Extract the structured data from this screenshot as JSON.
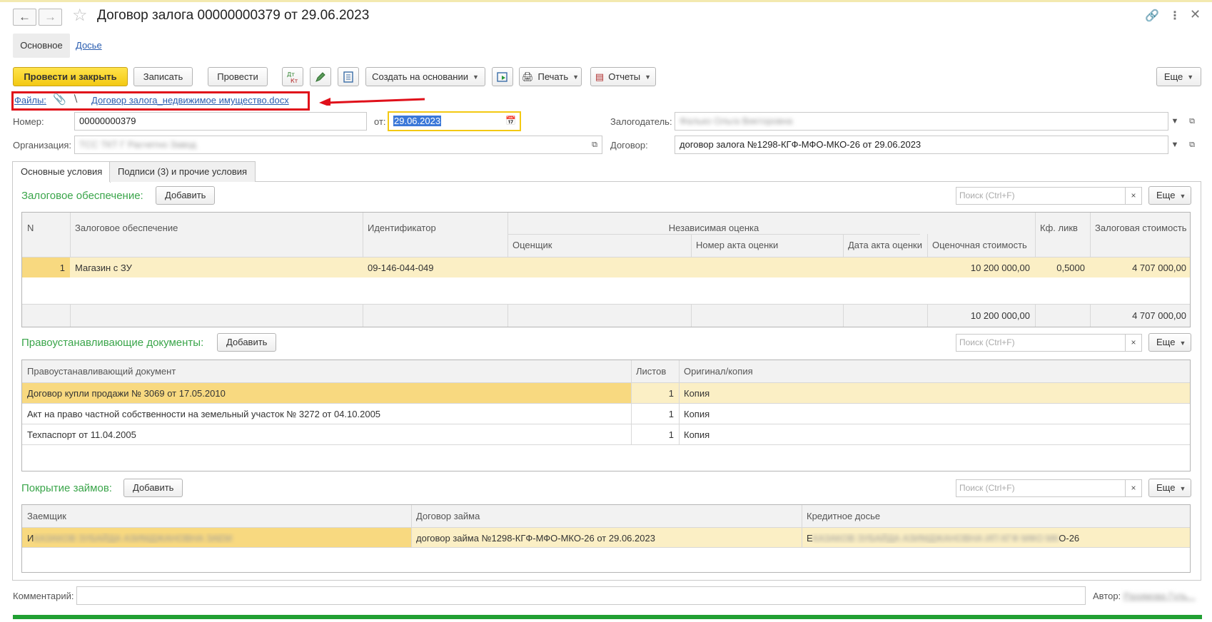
{
  "window": {
    "title": "Договор залога 00000000379 от 29.06.2023"
  },
  "section_tabs": [
    {
      "label": "Основное"
    },
    {
      "label": "Досье"
    }
  ],
  "toolbar": {
    "post_close": "Провести и закрыть",
    "save": "Записать",
    "post": "Провести",
    "create_based": "Создать на основании",
    "print": "Печать",
    "reports": "Отчеты",
    "more": "Еще"
  },
  "files": {
    "label": "Файлы:",
    "file_name": "Договор залога_недвижимое имущество.docx"
  },
  "fields": {
    "number_label": "Номер:",
    "number_value": "00000000379",
    "date_label": "от:",
    "date_value": "29.06.2023",
    "pledger_label": "Залогодатель:",
    "pledger_value": "Фалько Ольга Викторовна",
    "org_label": "Организация:",
    "org_value": "ТСС ТКТ Г Расчетно Завод",
    "contract_label": "Договор:",
    "contract_value": "договор залога №1298-КГФ-МФО-МКО-26 от 29.06.2023"
  },
  "tabs": [
    {
      "label": "Основные условия"
    },
    {
      "label": "Подписи (3) и прочие условия"
    }
  ],
  "collateral": {
    "title": "Залоговое обеспечение:",
    "add": "Добавить",
    "search_placeholder": "Поиск (Ctrl+F)",
    "more": "Еще",
    "headers": {
      "n": "N",
      "collateral": "Залоговое обеспечение",
      "identifier": "Идентификатор",
      "independent": "Независимая оценка",
      "appraiser": "Оценщик",
      "act_number": "Номер акта оценки",
      "act_date": "Дата акта оценки",
      "appraised_value": "Оценочная стоимость",
      "liq_coef": "Кф. ликв",
      "pledge_value": "Залоговая стоимость"
    },
    "rows": [
      {
        "n": "1",
        "collateral": "Магазин с ЗУ",
        "identifier": "09-146-044-049",
        "appraiser": "",
        "act_number": "",
        "act_date": "",
        "appraised_value": "10 200 000,00",
        "liq_coef": "0,5000",
        "pledge_value": "4 707 000,00"
      }
    ],
    "totals": {
      "appraised_value": "10 200 000,00",
      "pledge_value": "4 707 000,00"
    }
  },
  "title_docs": {
    "title": "Правоустанавливающие документы:",
    "add": "Добавить",
    "search_placeholder": "Поиск (Ctrl+F)",
    "more": "Еще",
    "headers": {
      "doc": "Правоустанавливающий документ",
      "sheets": "Листов",
      "original": "Оригинал/копия"
    },
    "rows": [
      {
        "doc": "Договор купли продажи № 3069 от 17.05.2010",
        "sheets": "1",
        "original": "Копия"
      },
      {
        "doc": "Акт на право частной собственности на земельный участок № 3272 от 04.10.2005",
        "sheets": "1",
        "original": "Копия"
      },
      {
        "doc": "Техпаспорт от 11.04.2005",
        "sheets": "1",
        "original": "Копия"
      }
    ]
  },
  "loans": {
    "title": "Покрытие займов:",
    "add": "Добавить",
    "search_placeholder": "Поиск (Ctrl+F)",
    "more": "Еще",
    "headers": {
      "borrower": "Заемщик",
      "loan_contract": "Договор займа",
      "credit_file": "Кредитное досье"
    },
    "rows": [
      {
        "borrower": "И",
        "borrower_hidden": "КАЗАКОВ ЗУБАЙДА АЗИМДЖАНОВНА ЗАЕМ",
        "loan_contract": "договор займа №1298-КГФ-МФО-МКО-26 от 29.06.2023",
        "credit_file": "Е",
        "credit_hidden": "КАЗАКОВ ЗУБАЙДА АЗИМДЖАНОВНА ИП КГФ МФО МК",
        "credit_suffix": "О-26"
      }
    ]
  },
  "footer": {
    "comment_label": "Комментарий:",
    "author_label": "Автор:",
    "author_value": "Рахимова Гуль..."
  },
  "colors": {
    "accent_yellow": "#f3c913",
    "group_title_green": "#3aa54a",
    "selection_row": "#fbefc5",
    "highlight_red": "#e0101a",
    "status_bar_green": "#21a033"
  }
}
